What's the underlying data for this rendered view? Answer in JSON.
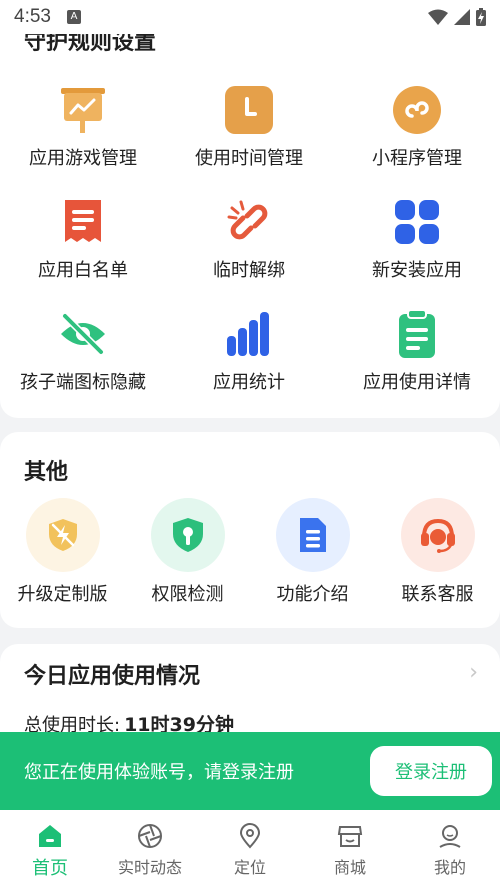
{
  "status_bar": {
    "time": "4:53"
  },
  "rules": {
    "title": "守护规则设置",
    "items": [
      {
        "label": "应用游戏管理",
        "icon": "app-game-icon"
      },
      {
        "label": "使用时间管理",
        "icon": "clock-icon"
      },
      {
        "label": "小程序管理",
        "icon": "mini-program-icon"
      },
      {
        "label": "应用白名单",
        "icon": "whitelist-icon"
      },
      {
        "label": "临时解绑",
        "icon": "unlink-icon"
      },
      {
        "label": "新安装应用",
        "icon": "grid-apps-icon"
      },
      {
        "label": "孩子端图标隐藏",
        "icon": "eye-hidden-icon"
      },
      {
        "label": "应用统计",
        "icon": "bar-chart-icon"
      },
      {
        "label": "应用使用详情",
        "icon": "clipboard-icon"
      }
    ]
  },
  "other": {
    "title": "其他",
    "items": [
      {
        "label": "升级定制版",
        "icon": "upgrade-icon"
      },
      {
        "label": "权限检测",
        "icon": "shield-key-icon"
      },
      {
        "label": "功能介绍",
        "icon": "document-icon"
      },
      {
        "label": "联系客服",
        "icon": "headset-icon"
      }
    ]
  },
  "today": {
    "title": "今日应用使用情况",
    "total_label": "总使用时长:",
    "total_value": "11时39分钟"
  },
  "login_banner": {
    "message": "您正在使用体验账号，请登录注册",
    "button": "登录注册"
  },
  "tabs": [
    {
      "label": "首页",
      "icon": "home-icon",
      "active": true
    },
    {
      "label": "实时动态",
      "icon": "aperture-icon",
      "active": false
    },
    {
      "label": "定位",
      "icon": "location-pin-icon",
      "active": false
    },
    {
      "label": "商城",
      "icon": "store-icon",
      "active": false
    },
    {
      "label": "我的",
      "icon": "profile-icon",
      "active": false
    }
  ],
  "colors": {
    "accent": "#1cbf76",
    "orange": "#e8a247",
    "red": "#e8573a",
    "blue": "#2f63e0",
    "green": "#2ec27e"
  }
}
